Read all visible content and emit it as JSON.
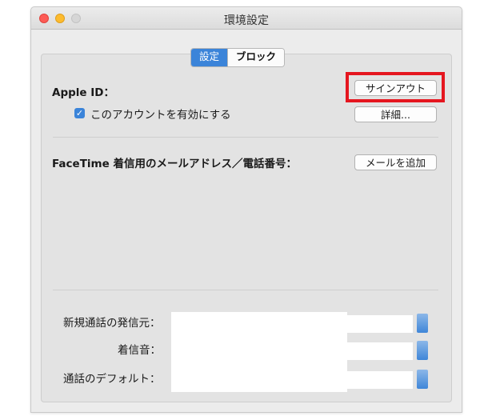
{
  "window": {
    "title": "環境設定"
  },
  "tabs": [
    {
      "label": "設定"
    },
    {
      "label": "ブロック"
    }
  ],
  "apple_id": {
    "label": "Apple ID：",
    "enable_checkbox_label": "このアカウントを有効にする",
    "enabled": true,
    "sign_out_button": "サインアウト",
    "details_button": "詳細..."
  },
  "facetime": {
    "label": "FaceTime 着信用のメールアドレス／電話番号：",
    "add_email_button": "メールを追加"
  },
  "settings": {
    "caller_id_label": "新規通話の発信元：",
    "ringtone_label": "着信音：",
    "default_label": "通話のデフォルト："
  },
  "icons": {
    "checkbox": "checkmark-icon",
    "traffic_lights": [
      "close",
      "minimize",
      "zoom"
    ]
  },
  "colors": {
    "accent": "#3b84d9",
    "highlight": "#e5161f"
  }
}
